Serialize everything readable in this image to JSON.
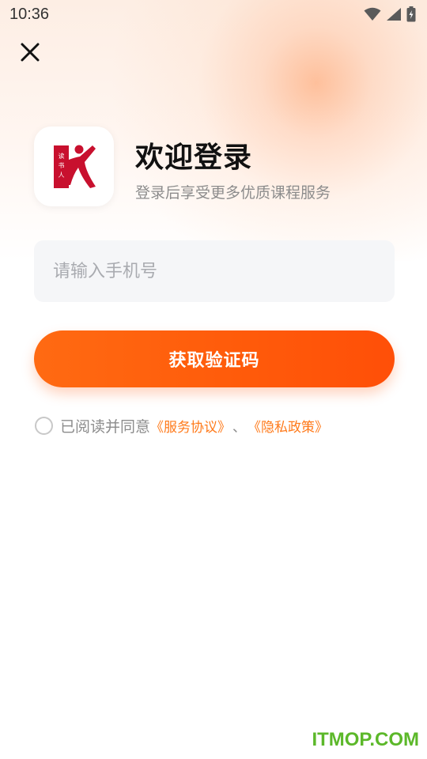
{
  "status_bar": {
    "time": "10:36",
    "icons": [
      "wifi-icon",
      "signal-icon",
      "battery-charging-icon"
    ]
  },
  "header": {
    "close_icon": "close-icon"
  },
  "brand": {
    "logo": "app-logo",
    "logo_text": "读书人",
    "logo_color": "#c8102e"
  },
  "welcome": {
    "title": "欢迎登录",
    "subtitle": "登录后享受更多优质课程服务"
  },
  "form": {
    "phone_placeholder": "请输入手机号",
    "phone_value": "",
    "submit_label": "获取验证码"
  },
  "agreement": {
    "checked": false,
    "prefix": "已阅读并同意",
    "service_link": "《服务协议》",
    "separator": "、",
    "privacy_link": "《隐私政策》"
  },
  "watermark": {
    "text": "ITMOP.COM"
  },
  "colors": {
    "accent": "#ff5a0a",
    "link": "#ff7a1a",
    "watermark": "#5cb82a"
  }
}
